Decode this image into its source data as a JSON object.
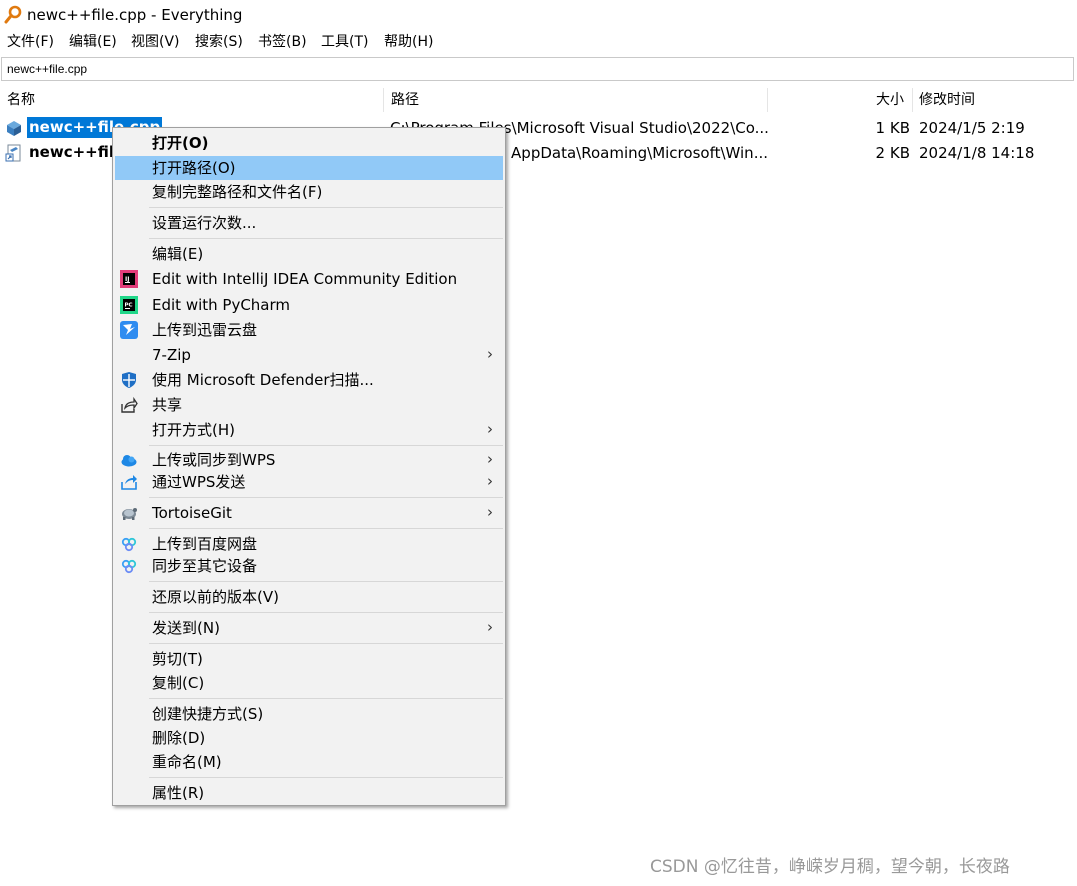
{
  "window": {
    "title": "newc++file.cpp - Everything"
  },
  "menu": [
    "文件(F)",
    "编辑(E)",
    "视图(V)",
    "搜索(S)",
    "书签(B)",
    "工具(T)",
    "帮助(H)"
  ],
  "search": {
    "value": "newc++file.cpp"
  },
  "columns": {
    "name": "名称",
    "path": "路径",
    "size": "大小",
    "modified": "修改时间"
  },
  "rows": [
    {
      "name": "newc++file.cpp",
      "path": "C:\\Program Files\\Microsoft Visual Studio\\2022\\Co...",
      "size": "1 KB",
      "date": "2024/1/5 2:19",
      "selected": true
    },
    {
      "name": "newc++file",
      "path": "AppData\\Roaming\\Microsoft\\Win...",
      "size": "2 KB",
      "date": "2024/1/8 14:18",
      "selected": false
    }
  ],
  "context_menu": [
    {
      "label": "打开(O)",
      "bold": true
    },
    {
      "label": "打开路径(O)",
      "highlighted": true
    },
    {
      "label": "复制完整路径和文件名(F)"
    },
    {
      "label": "设置运行次数..."
    },
    {
      "label": "编辑(E)"
    },
    {
      "label": "Edit with IntelliJ IDEA Community Edition",
      "icon": "intellij-idea-icon"
    },
    {
      "label": "Edit with PyCharm",
      "icon": "pycharm-icon"
    },
    {
      "label": "上传到迅雷云盘",
      "icon": "thunder-cloud-icon"
    },
    {
      "label": "7-Zip",
      "submenu": true
    },
    {
      "label": "使用 Microsoft Defender扫描...",
      "icon": "defender-shield-icon"
    },
    {
      "label": "共享",
      "icon": "share-icon"
    },
    {
      "label": "打开方式(H)",
      "submenu": true
    },
    {
      "label": "上传或同步到WPS",
      "icon": "wps-cloud-icon",
      "submenu": true
    },
    {
      "label": "通过WPS发送",
      "icon": "wps-send-icon",
      "submenu": true
    },
    {
      "label": "TortoiseGit",
      "icon": "tortoisegit-icon",
      "submenu": true
    },
    {
      "label": "上传到百度网盘",
      "icon": "baidu-netdisk-icon"
    },
    {
      "label": "同步至其它设备",
      "icon": "baidu-sync-icon"
    },
    {
      "label": "还原以前的版本(V)"
    },
    {
      "label": "发送到(N)",
      "submenu": true
    },
    {
      "label": "剪切(T)"
    },
    {
      "label": "复制(C)"
    },
    {
      "label": "创建快捷方式(S)"
    },
    {
      "label": "删除(D)"
    },
    {
      "label": "重命名(M)"
    },
    {
      "label": "属性(R)"
    }
  ],
  "submenu_arrow": "›",
  "watermark": "CSDN @忆往昔，峥嵘岁月稠，望今朝，长夜路",
  "colors": {
    "selection": "#0078d7",
    "menu_highlight": "#91c9f7"
  }
}
